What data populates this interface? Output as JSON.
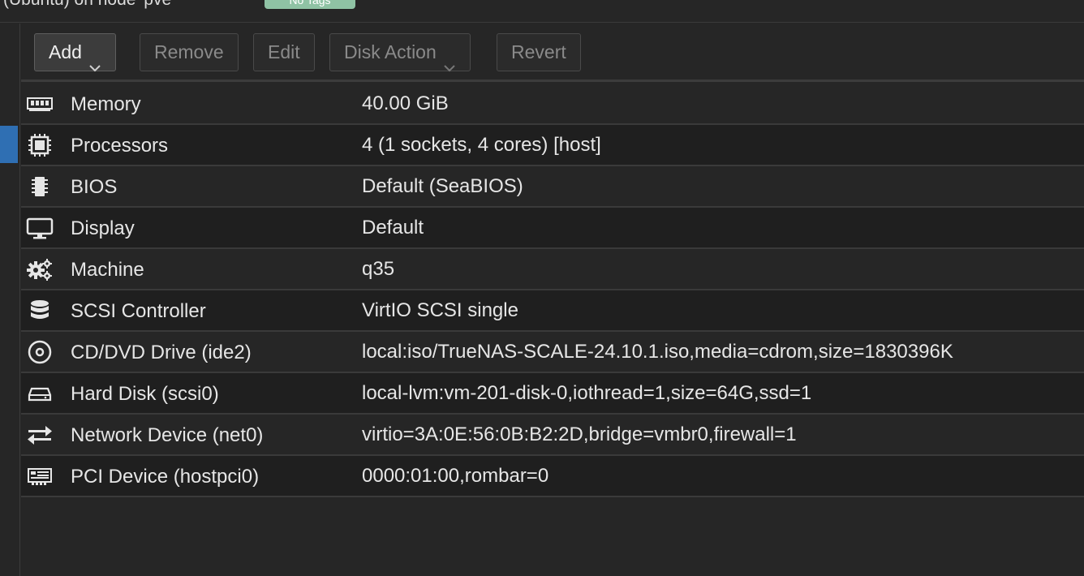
{
  "header": {
    "breadcrumb_partial": "(Ubuntu) on node 'pve'",
    "status_tag": "No Tags"
  },
  "toolbar": {
    "add": "Add",
    "remove": "Remove",
    "edit": "Edit",
    "disk_action": "Disk Action",
    "revert": "Revert"
  },
  "hardware": {
    "rows": [
      {
        "name": "Memory",
        "value": "40.00 GiB",
        "icon": "memory-icon"
      },
      {
        "name": "Processors",
        "value": "4 (1 sockets, 4 cores) [host]",
        "icon": "cpu-icon"
      },
      {
        "name": "BIOS",
        "value": "Default (SeaBIOS)",
        "icon": "bios-chip-icon"
      },
      {
        "name": "Display",
        "value": "Default",
        "icon": "monitor-icon"
      },
      {
        "name": "Machine",
        "value": "q35",
        "icon": "gears-icon"
      },
      {
        "name": "SCSI Controller",
        "value": "VirtIO SCSI single",
        "icon": "database-icon"
      },
      {
        "name": "CD/DVD Drive (ide2)",
        "value": "local:iso/TrueNAS-SCALE-24.10.1.iso,media=cdrom,size=1830396K",
        "icon": "disc-icon"
      },
      {
        "name": "Hard Disk (scsi0)",
        "value": "local-lvm:vm-201-disk-0,iothread=1,size=64G,ssd=1",
        "icon": "hdd-icon"
      },
      {
        "name": "Network Device (net0)",
        "value": "virtio=3A:0E:56:0B:B2:2D,bridge=vmbr0,firewall=1",
        "icon": "exchange-arrows-icon"
      },
      {
        "name": "PCI Device (hostpci0)",
        "value": "0000:01:00,rombar=0",
        "icon": "pci-card-icon"
      }
    ]
  },
  "colors": {
    "background": "#262626",
    "row_alt": "#1f1f1f",
    "selection_blue": "#2f6fb3",
    "tag_green": "#8fc2a4"
  }
}
